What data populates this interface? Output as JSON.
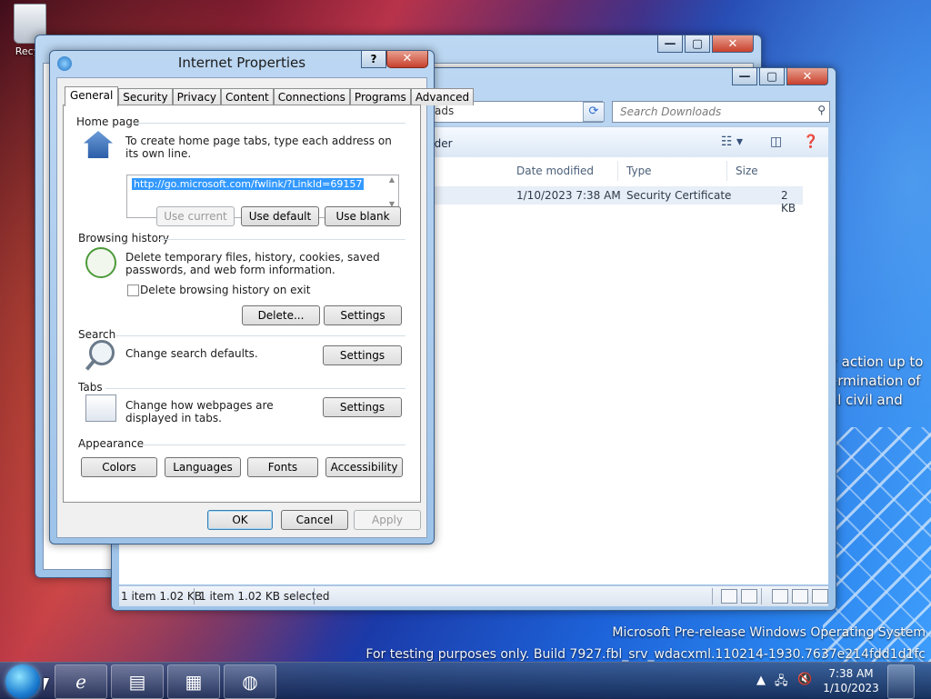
{
  "desktop": {
    "recycle_label": "Recyc",
    "side_text": [
      "y action up to",
      "ermination of",
      "al civil and"
    ],
    "watermark_line1": "Microsoft Pre-release Windows Operating System",
    "watermark_line2": "For testing purposes only. Build 7927.fbl_srv_wdacxml.110214-1930.7637e214fdd1d1fc"
  },
  "explorer": {
    "address_text": "ads",
    "search_placeholder": "Search Downloads",
    "toolbar_label": "older",
    "columns": [
      "Date modified",
      "Type",
      "Size"
    ],
    "file_row": {
      "date": "1/10/2023 7:38 AM",
      "type": "Security Certificate",
      "size": "2 KB"
    },
    "status_left": "1 item 1.02 KB",
    "status_right": "1 item 1.02 KB selected"
  },
  "dialog": {
    "title": "Internet Properties",
    "help_label": "?",
    "close_label": "✕",
    "tabs": [
      "General",
      "Security",
      "Privacy",
      "Content",
      "Connections",
      "Programs",
      "Advanced"
    ],
    "home_page": {
      "group": "Home page",
      "instruction": "To create home page tabs, type each address on its own line.",
      "url": "http://go.microsoft.com/fwlink/?LinkId=69157",
      "btn_current": "Use current",
      "btn_default": "Use default",
      "btn_blank": "Use blank"
    },
    "history": {
      "group": "Browsing history",
      "desc": "Delete temporary files, history, cookies, saved passwords, and web form information.",
      "checkbox": "Delete browsing history on exit",
      "btn_delete": "Delete...",
      "btn_settings": "Settings"
    },
    "search": {
      "group": "Search",
      "desc": "Change search defaults.",
      "btn_settings": "Settings"
    },
    "tabs_section": {
      "group": "Tabs",
      "desc": "Change how webpages are displayed in tabs.",
      "btn_settings": "Settings"
    },
    "appearance": {
      "group": "Appearance",
      "colors": "Colors",
      "languages": "Languages",
      "fonts": "Fonts",
      "accessibility": "Accessibility"
    },
    "ok": "OK",
    "cancel": "Cancel",
    "apply": "Apply"
  },
  "taskbar": {
    "time": "7:38 AM",
    "date": "1/10/2023"
  }
}
